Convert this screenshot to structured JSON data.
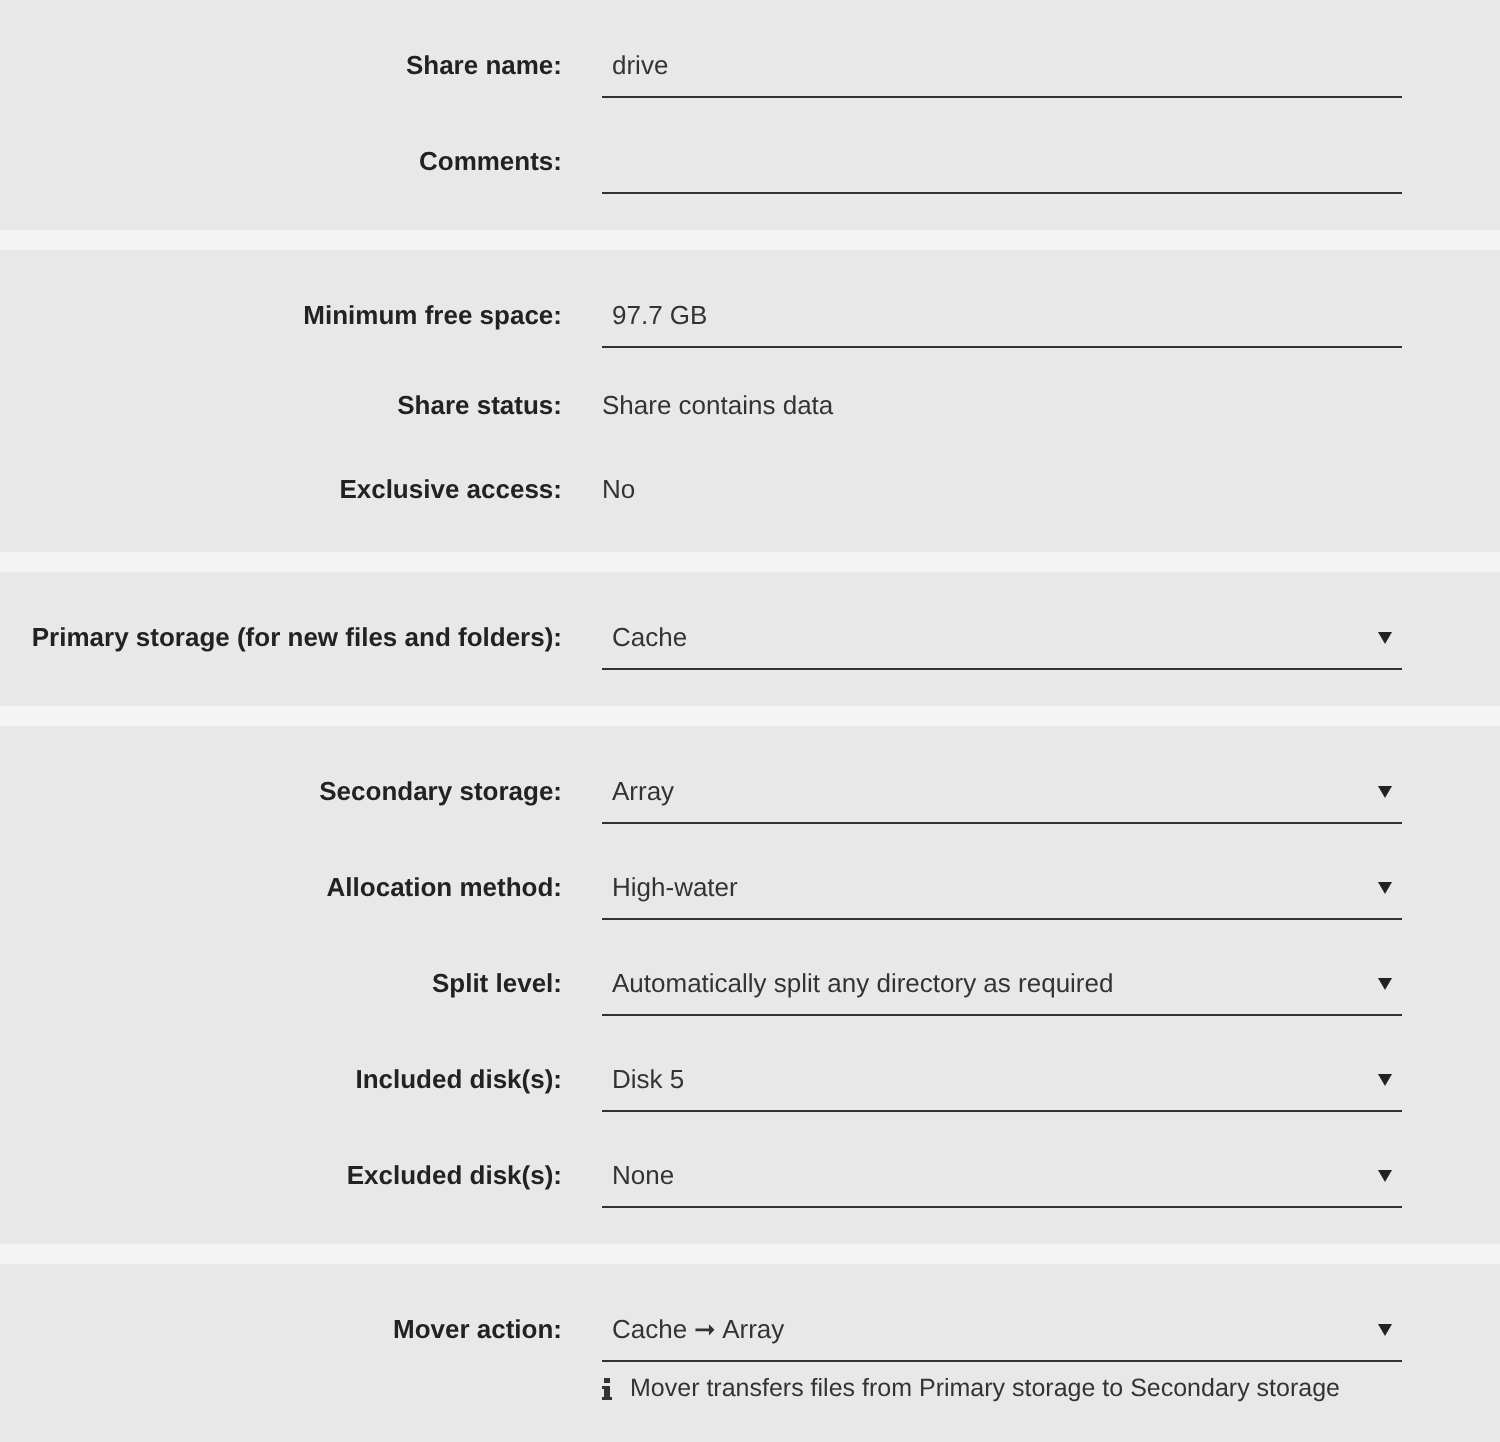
{
  "sections": [
    {
      "rows": [
        {
          "kind": "input",
          "label": "Share name:",
          "value": "drive"
        },
        {
          "kind": "input",
          "label": "Comments:",
          "value": ""
        }
      ]
    },
    {
      "rows": [
        {
          "kind": "input",
          "label": "Minimum free space:",
          "value": "97.7 GB"
        },
        {
          "kind": "text",
          "label": "Share status:",
          "value": "Share contains data"
        },
        {
          "kind": "text",
          "label": "Exclusive access:",
          "value": "No"
        }
      ]
    },
    {
      "rows": [
        {
          "kind": "select",
          "label": "Primary storage (for new files and folders):",
          "value": "Cache"
        }
      ]
    },
    {
      "rows": [
        {
          "kind": "select",
          "label": "Secondary storage:",
          "value": "Array"
        },
        {
          "kind": "select",
          "label": "Allocation method:",
          "value": "High-water"
        },
        {
          "kind": "select",
          "label": "Split level:",
          "value": "Automatically split any directory as required"
        },
        {
          "kind": "select",
          "label": "Included disk(s):",
          "value": "Disk 5"
        },
        {
          "kind": "select",
          "label": "Excluded disk(s):",
          "value": "None"
        }
      ]
    },
    {
      "rows": [
        {
          "kind": "select",
          "label": "Mover action:",
          "value": "Cache ➞ Array",
          "note": "Mover transfers files from Primary storage to Secondary storage"
        }
      ]
    }
  ]
}
